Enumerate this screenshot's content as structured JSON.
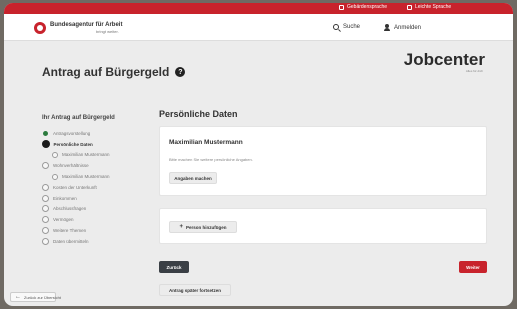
{
  "topbar": {
    "links": [
      {
        "label": "Gebärdensprache",
        "icon": "sign-language-icon"
      },
      {
        "label": "Leichte Sprache",
        "icon": "easy-language-icon"
      }
    ]
  },
  "header": {
    "logo_name": "Bundesagentur für Arbeit",
    "logo_sub": "bringt weiter.",
    "search_label": "Suche",
    "login_label": "Anmelden"
  },
  "page": {
    "title": "Antrag auf Bürgergeld",
    "help_icon": "?",
    "jobcenter_label": "Jobcenter",
    "jobcenter_sub": "Alles für dich"
  },
  "sidebar": {
    "title": "Ihr Antrag auf Bürgergeld",
    "steps": [
      {
        "label": "Antragsvorstellung",
        "state": "done"
      },
      {
        "label": "Persönliche Daten",
        "state": "active"
      },
      {
        "label": "Maximilian Mustermann",
        "state": "sub"
      },
      {
        "label": "Wohnverhältnisse",
        "state": "todo"
      },
      {
        "label": "Maximilian Mustermann",
        "state": "sub"
      },
      {
        "label": "Kosten der Unterkunft",
        "state": "todo"
      },
      {
        "label": "Einkommen",
        "state": "todo"
      },
      {
        "label": "Abschlussfragen",
        "state": "todo"
      },
      {
        "label": "Vermögen",
        "state": "todo"
      },
      {
        "label": "Weitere Themen",
        "state": "todo"
      },
      {
        "label": "Daten übermitteln",
        "state": "todo"
      }
    ]
  },
  "main": {
    "section_title": "Persönliche Daten",
    "person": {
      "name": "Maximilian Mustermann",
      "description": "Bitte machen Sie weitere persönliche Angaben.",
      "edit_button": "Angaben machen"
    },
    "add_person_button": "Person hinzufügen",
    "back_button": "Zurück",
    "next_button": "Weiter",
    "save_button": "Antrag später fortsetzen"
  },
  "footer": {
    "back_link": "Zurück zur Übersicht"
  }
}
